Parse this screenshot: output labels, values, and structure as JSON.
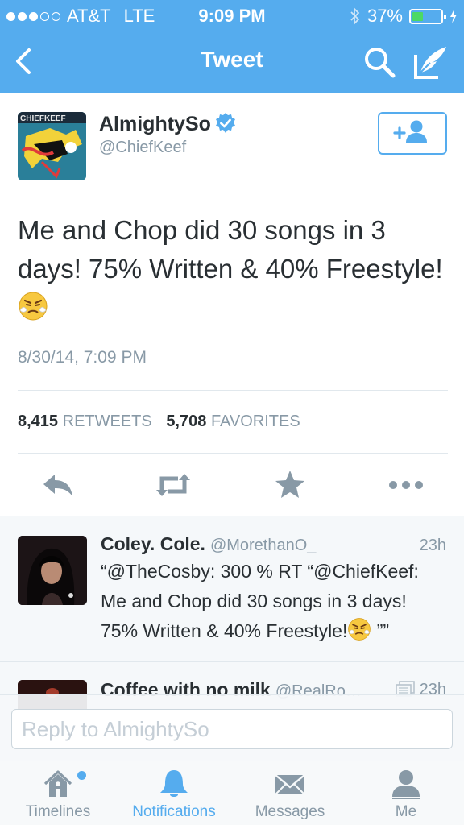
{
  "status_bar": {
    "carrier": "AT&T",
    "network": "LTE",
    "time": "9:09 PM",
    "battery": "37%",
    "battery_level": 0.37,
    "signal_bars_filled": 3,
    "signal_bars_total": 5
  },
  "nav": {
    "title": "Tweet",
    "icons": [
      "back-chevron-icon",
      "search-icon",
      "compose-icon"
    ]
  },
  "tweet": {
    "author_name": "AlmightySo",
    "author_handle": "@ChiefKeef",
    "avatar_text": "CHIEFKEEF",
    "text": "Me and Chop did 30 songs in 3 days! 75% Written & 40% Freestyle!",
    "emoji": "angry-face-emoji",
    "date": "8/30/14, 7:09 PM",
    "retweets_count": "8,415",
    "retweets_label": "RETWEETS",
    "favorites_count": "5,708",
    "favorites_label": "FAVORITES"
  },
  "actions": [
    "reply-icon",
    "retweet-icon",
    "favorite-star-icon",
    "more-icon"
  ],
  "replies": [
    {
      "name": "Coley. Cole.",
      "handle": "@MorethanO_",
      "time": "23h",
      "text": "“@TheCosby: 300 % RT “@ChiefKeef: Me and Chop did 30 songs in 3 days! 75% Written & 40% Freestyle!",
      "text_suffix": "””"
    },
    {
      "name": "Coffee with no milk",
      "handle": "@RealRo…",
      "time": "23h"
    }
  ],
  "reply_box": {
    "placeholder": "Reply to AlmightySo"
  },
  "tabs": [
    {
      "label": "Timelines",
      "icon": "home-icon"
    },
    {
      "label": "Notifications",
      "icon": "bell-icon"
    },
    {
      "label": "Messages",
      "icon": "envelope-icon"
    },
    {
      "label": "Me",
      "icon": "person-icon"
    }
  ],
  "colors": {
    "brand_blue": "#55acee",
    "gray_text": "#8899a6",
    "dark_text": "#292f33"
  }
}
